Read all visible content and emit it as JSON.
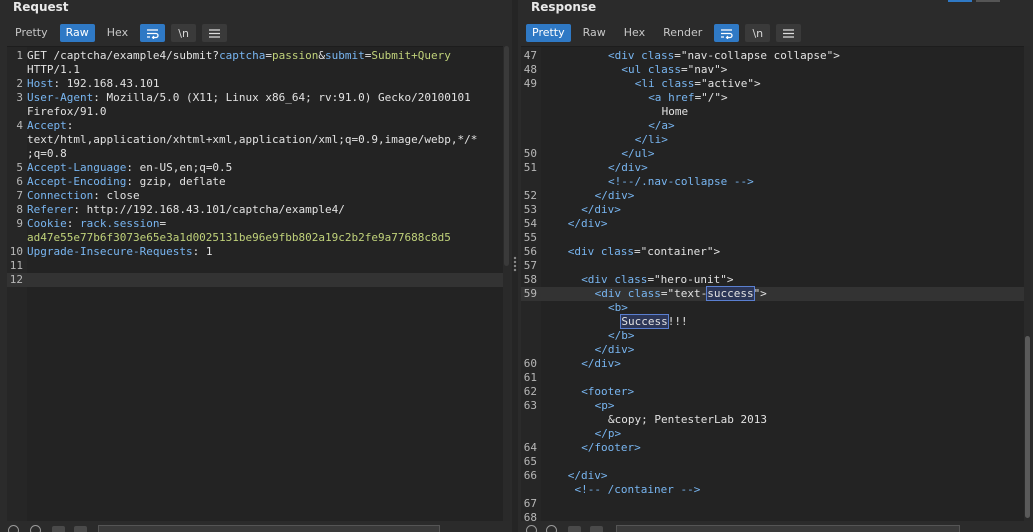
{
  "request": {
    "title": "Request",
    "tabs": [
      {
        "label": "Pretty",
        "active": false
      },
      {
        "label": "Raw",
        "active": true
      },
      {
        "label": "Hex",
        "active": false
      }
    ],
    "tools": {
      "wrap_icon": "wrap-lines-icon",
      "newline_label": "\\n",
      "menu_icon": "hamburger-menu-icon"
    },
    "lines": [
      {
        "num": "1",
        "parts": [
          {
            "t": "GET /captcha/example4/submit?",
            "c": "t"
          },
          {
            "t": "captcha",
            "c": "k"
          },
          {
            "t": "=",
            "c": "t"
          },
          {
            "t": "passion",
            "c": "v"
          },
          {
            "t": "&",
            "c": "t"
          },
          {
            "t": "submit",
            "c": "k"
          },
          {
            "t": "=",
            "c": "t"
          },
          {
            "t": "Submit+Query",
            "c": "v"
          }
        ]
      },
      {
        "num": "",
        "parts": [
          {
            "t": "HTTP/1.1",
            "c": "t"
          }
        ]
      },
      {
        "num": "2",
        "parts": [
          {
            "t": "Host",
            "c": "k"
          },
          {
            "t": ": 192.168.43.101",
            "c": "t"
          }
        ]
      },
      {
        "num": "3",
        "parts": [
          {
            "t": "User-Agent",
            "c": "k"
          },
          {
            "t": ": Mozilla/5.0 (X11; Linux x86_64; rv:91.0) Gecko/20100101",
            "c": "t"
          }
        ]
      },
      {
        "num": "",
        "parts": [
          {
            "t": "Firefox/91.0",
            "c": "t"
          }
        ]
      },
      {
        "num": "4",
        "parts": [
          {
            "t": "Accept",
            "c": "k"
          },
          {
            "t": ":",
            "c": "t"
          }
        ]
      },
      {
        "num": "",
        "parts": [
          {
            "t": "text/html,application/xhtml+xml,application/xml;q=0.9,image/webp,*/*",
            "c": "t"
          }
        ]
      },
      {
        "num": "",
        "parts": [
          {
            "t": ";q=0.8",
            "c": "t"
          }
        ]
      },
      {
        "num": "5",
        "parts": [
          {
            "t": "Accept-Language",
            "c": "k"
          },
          {
            "t": ": en-US,en;q=0.5",
            "c": "t"
          }
        ]
      },
      {
        "num": "6",
        "parts": [
          {
            "t": "Accept-Encoding",
            "c": "k"
          },
          {
            "t": ": gzip, deflate",
            "c": "t"
          }
        ]
      },
      {
        "num": "7",
        "parts": [
          {
            "t": "Connection",
            "c": "k"
          },
          {
            "t": ": close",
            "c": "t"
          }
        ]
      },
      {
        "num": "8",
        "parts": [
          {
            "t": "Referer",
            "c": "k"
          },
          {
            "t": ": http://192.168.43.101/captcha/example4/",
            "c": "t"
          }
        ]
      },
      {
        "num": "9",
        "parts": [
          {
            "t": "Cookie",
            "c": "k"
          },
          {
            "t": ": ",
            "c": "t"
          },
          {
            "t": "rack.session",
            "c": "k"
          },
          {
            "t": "=",
            "c": "t"
          }
        ]
      },
      {
        "num": "",
        "parts": [
          {
            "t": "ad47e55e77b6f3073e65e3a1d0025131be96e9fbb802a19c2b2fe9a77688c8d5",
            "c": "v"
          }
        ]
      },
      {
        "num": "10",
        "parts": [
          {
            "t": "Upgrade-Insecure-Requests",
            "c": "k"
          },
          {
            "t": ": 1",
            "c": "t"
          }
        ]
      },
      {
        "num": "11",
        "parts": []
      },
      {
        "num": "12",
        "parts": [],
        "current": true
      }
    ]
  },
  "response": {
    "title": "Response",
    "tabs": [
      {
        "label": "Pretty",
        "active": true
      },
      {
        "label": "Raw",
        "active": false
      },
      {
        "label": "Hex",
        "active": false
      },
      {
        "label": "Render",
        "active": false
      }
    ],
    "tools": {
      "wrap_icon": "wrap-lines-icon",
      "newline_label": "\\n",
      "menu_icon": "hamburger-menu-icon"
    },
    "lines": [
      {
        "num": "47",
        "indent": 10,
        "parts": [
          {
            "t": "<div ",
            "c": "k"
          },
          {
            "t": "class",
            "c": "k"
          },
          {
            "t": "=\"nav-collapse collapse\">",
            "c": "t"
          }
        ]
      },
      {
        "num": "48",
        "indent": 12,
        "parts": [
          {
            "t": "<ul ",
            "c": "k"
          },
          {
            "t": "class",
            "c": "k"
          },
          {
            "t": "=\"nav\">",
            "c": "t"
          }
        ]
      },
      {
        "num": "49",
        "indent": 14,
        "parts": [
          {
            "t": "<li ",
            "c": "k"
          },
          {
            "t": "class",
            "c": "k"
          },
          {
            "t": "=\"active\">",
            "c": "t"
          }
        ]
      },
      {
        "num": "",
        "indent": 16,
        "parts": [
          {
            "t": "<a ",
            "c": "k"
          },
          {
            "t": "href",
            "c": "k"
          },
          {
            "t": "=\"/\">",
            "c": "t"
          }
        ]
      },
      {
        "num": "",
        "indent": 18,
        "parts": [
          {
            "t": "Home",
            "c": "t"
          }
        ]
      },
      {
        "num": "",
        "indent": 16,
        "parts": [
          {
            "t": "</a>",
            "c": "k"
          }
        ]
      },
      {
        "num": "",
        "indent": 14,
        "parts": [
          {
            "t": "</li>",
            "c": "k"
          }
        ]
      },
      {
        "num": "50",
        "indent": 12,
        "parts": [
          {
            "t": "</ul>",
            "c": "k"
          }
        ]
      },
      {
        "num": "51",
        "indent": 10,
        "parts": [
          {
            "t": "</div>",
            "c": "k"
          }
        ]
      },
      {
        "num": "",
        "indent": 10,
        "parts": [
          {
            "t": "<!--/.nav-collapse -->",
            "c": "k"
          }
        ]
      },
      {
        "num": "52",
        "indent": 8,
        "parts": [
          {
            "t": "</div>",
            "c": "k"
          }
        ]
      },
      {
        "num": "53",
        "indent": 6,
        "parts": [
          {
            "t": "</div>",
            "c": "k"
          }
        ]
      },
      {
        "num": "54",
        "indent": 4,
        "parts": [
          {
            "t": "</div>",
            "c": "k"
          }
        ]
      },
      {
        "num": "55",
        "indent": 0,
        "parts": []
      },
      {
        "num": "56",
        "indent": 4,
        "parts": [
          {
            "t": "<div ",
            "c": "k"
          },
          {
            "t": "class",
            "c": "k"
          },
          {
            "t": "=\"container\">",
            "c": "t"
          }
        ]
      },
      {
        "num": "57",
        "indent": 0,
        "parts": []
      },
      {
        "num": "58",
        "indent": 6,
        "parts": [
          {
            "t": "<div ",
            "c": "k"
          },
          {
            "t": "class",
            "c": "k"
          },
          {
            "t": "=\"hero-unit\">",
            "c": "t"
          }
        ]
      },
      {
        "num": "59",
        "indent": 8,
        "current": true,
        "parts": [
          {
            "t": "<div ",
            "c": "k"
          },
          {
            "t": "class",
            "c": "k"
          },
          {
            "t": "=\"text-",
            "c": "t"
          },
          {
            "t": "success",
            "c": "t",
            "hl": true
          },
          {
            "t": "\">",
            "c": "t"
          }
        ]
      },
      {
        "num": "",
        "indent": 10,
        "parts": [
          {
            "t": "<b>",
            "c": "k"
          }
        ]
      },
      {
        "num": "",
        "indent": 12,
        "parts": [
          {
            "t": "Success",
            "c": "t",
            "hl": true
          },
          {
            "t": "!!!",
            "c": "t"
          }
        ]
      },
      {
        "num": "",
        "indent": 10,
        "parts": [
          {
            "t": "</b>",
            "c": "k"
          }
        ]
      },
      {
        "num": "",
        "indent": 8,
        "parts": [
          {
            "t": "</div>",
            "c": "k"
          }
        ]
      },
      {
        "num": "60",
        "indent": 6,
        "parts": [
          {
            "t": "</div>",
            "c": "k"
          }
        ]
      },
      {
        "num": "61",
        "indent": 0,
        "parts": []
      },
      {
        "num": "62",
        "indent": 6,
        "parts": [
          {
            "t": "<footer>",
            "c": "k"
          }
        ]
      },
      {
        "num": "63",
        "indent": 8,
        "parts": [
          {
            "t": "<p>",
            "c": "k"
          }
        ]
      },
      {
        "num": "",
        "indent": 10,
        "parts": [
          {
            "t": "&copy; PentesterLab 2013",
            "c": "t"
          }
        ]
      },
      {
        "num": "",
        "indent": 8,
        "parts": [
          {
            "t": "</p>",
            "c": "k"
          }
        ]
      },
      {
        "num": "64",
        "indent": 6,
        "parts": [
          {
            "t": "</footer>",
            "c": "k"
          }
        ]
      },
      {
        "num": "65",
        "indent": 0,
        "parts": []
      },
      {
        "num": "66",
        "indent": 4,
        "parts": [
          {
            "t": "</div>",
            "c": "k"
          }
        ]
      },
      {
        "num": "",
        "indent": 5,
        "parts": [
          {
            "t": "<!-- /container -->",
            "c": "k"
          }
        ]
      },
      {
        "num": "67",
        "indent": 0,
        "parts": []
      },
      {
        "num": "68",
        "indent": 0,
        "parts": []
      }
    ]
  }
}
